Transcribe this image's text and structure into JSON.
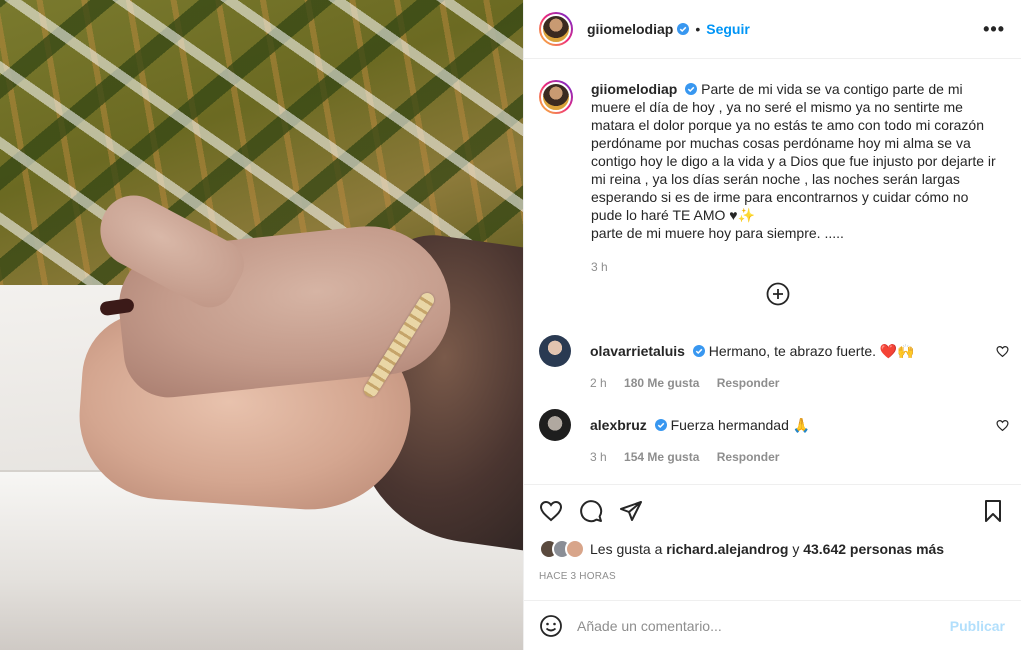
{
  "post": {
    "username": "giiomelodiap",
    "dot": "•",
    "follow_label": "Seguir",
    "more_label": "•••"
  },
  "caption": {
    "username": "giiomelodiap",
    "text": "Parte de mi vida se va contigo parte de mi muere el día de hoy , ya no seré el mismo ya no sentirte me matara el dolor porque ya no estás te amo con todo mi corazón perdóname por muchas cosas perdóname hoy mi alma se va contigo hoy le digo a la vida y a Dios que fue injusto por dejarte ir mi reina , ya los días serán noche , las noches serán largas esperando si es de irme para encontrarnos y cuidar cómo no pude lo haré TE AMO ♥✨",
    "text2": "parte de mi muere hoy para siempre. .....",
    "time": "3 h"
  },
  "comments": [
    {
      "username": "olavarrietaluis",
      "text": "Hermano, te abrazo fuerte. ❤️🙌",
      "time": "2 h",
      "likes": "180 Me gusta",
      "reply": "Responder"
    },
    {
      "username": "alexbruz",
      "text": "Fuerza hermandad 🙏",
      "time": "3 h",
      "likes": "154 Me gusta",
      "reply": "Responder"
    }
  ],
  "likes": {
    "prefix": "Les gusta a ",
    "user": "richard.alejandrog",
    "middle": " y ",
    "count": "43.642 personas más"
  },
  "ago": "HACE 3 HORAS",
  "add_comment": {
    "placeholder": "Añade un comentario...",
    "publish": "Publicar"
  },
  "colors": {
    "accent": "#0095f6",
    "verified": "#3897f0",
    "publish_disabled": "#b2dffc",
    "muted": "#8e8e8e"
  }
}
